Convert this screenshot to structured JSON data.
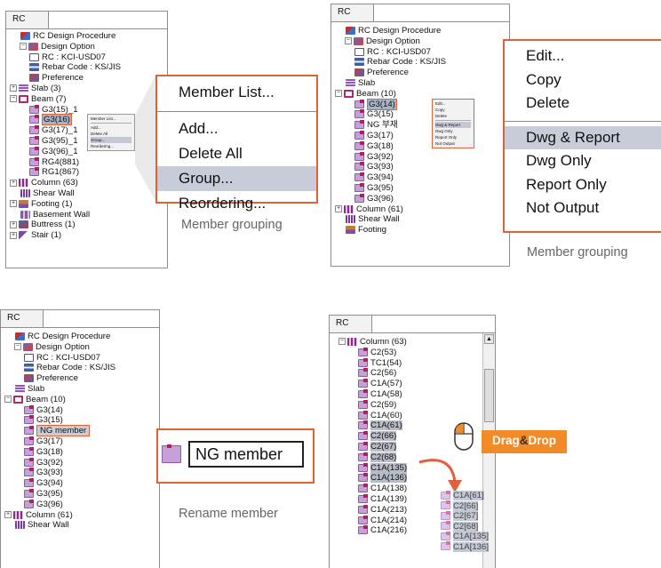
{
  "panel1": {
    "tab": "RC",
    "tree": [
      {
        "label": "RC Design Procedure",
        "indent": 0,
        "exp": "",
        "icon": "ic-root"
      },
      {
        "label": "Design Option",
        "indent": 1,
        "exp": "−",
        "icon": "ic-opt"
      },
      {
        "label": "RC : KCI-USD07",
        "indent": 2,
        "exp": "",
        "icon": "ic-rc"
      },
      {
        "label": "Rebar Code : KS/JIS",
        "indent": 2,
        "exp": "",
        "icon": "ic-rebar"
      },
      {
        "label": "Preference",
        "indent": 2,
        "exp": "",
        "icon": "ic-pref"
      },
      {
        "label": "Slab (3)",
        "indent": 0,
        "exp": "+",
        "icon": "ic-slab"
      },
      {
        "label": "Beam (7)",
        "indent": 0,
        "exp": "−",
        "icon": "ic-beam"
      },
      {
        "label": "G3(15)_1",
        "indent": 2,
        "exp": "",
        "icon": "ic-m"
      },
      {
        "label": "G3(16)",
        "indent": 2,
        "exp": "",
        "icon": "ic-m",
        "state": "sel"
      },
      {
        "label": "G3(17)_1",
        "indent": 2,
        "exp": "",
        "icon": "ic-m"
      },
      {
        "label": "G3(95)_1",
        "indent": 2,
        "exp": "",
        "icon": "ic-m"
      },
      {
        "label": "G3(96)_1",
        "indent": 2,
        "exp": "",
        "icon": "ic-m"
      },
      {
        "label": "RG4(881)",
        "indent": 2,
        "exp": "",
        "icon": "ic-m"
      },
      {
        "label": "RG1(867)",
        "indent": 2,
        "exp": "",
        "icon": "ic-m"
      },
      {
        "label": "Column (63)",
        "indent": 0,
        "exp": "+",
        "icon": "ic-col"
      },
      {
        "label": "Shear Wall",
        "indent": 0,
        "exp": "",
        "icon": "ic-wall"
      },
      {
        "label": "Footing (1)",
        "indent": 0,
        "exp": "+",
        "icon": "ic-foot"
      },
      {
        "label": "Basement Wall",
        "indent": 0,
        "exp": "",
        "icon": "ic-base"
      },
      {
        "label": "Buttress (1)",
        "indent": 0,
        "exp": "+",
        "icon": "ic-butt"
      },
      {
        "label": "Stair (1)",
        "indent": 0,
        "exp": "+",
        "icon": "ic-stair"
      }
    ],
    "context_menu": [
      {
        "label": "Member List..."
      },
      {
        "sep": true
      },
      {
        "label": "Add..."
      },
      {
        "label": "Delete All"
      },
      {
        "label": "Group...",
        "active": true
      },
      {
        "label": "Reordering..."
      }
    ],
    "zoom_menu": [
      {
        "label": "Member List..."
      },
      {
        "sep": true
      },
      {
        "label": "Add..."
      },
      {
        "label": "Delete All"
      },
      {
        "label": "Group...",
        "active": true
      },
      {
        "label": "Reordering..."
      }
    ],
    "caption": "Member grouping"
  },
  "panel2": {
    "tab": "RC",
    "tree": [
      {
        "label": "RC Design Procedure",
        "indent": 0,
        "exp": "",
        "icon": "ic-root"
      },
      {
        "label": "Design Option",
        "indent": 1,
        "exp": "−",
        "icon": "ic-opt"
      },
      {
        "label": "RC : KCI-USD07",
        "indent": 2,
        "exp": "",
        "icon": "ic-rc"
      },
      {
        "label": "Rebar Code : KS/JIS",
        "indent": 2,
        "exp": "",
        "icon": "ic-rebar"
      },
      {
        "label": "Preference",
        "indent": 2,
        "exp": "",
        "icon": "ic-pref"
      },
      {
        "label": "Slab",
        "indent": 0,
        "exp": "",
        "icon": "ic-slab"
      },
      {
        "label": "Beam (10)",
        "indent": 0,
        "exp": "−",
        "icon": "ic-beam"
      },
      {
        "label": "G3(14)",
        "indent": 2,
        "exp": "",
        "icon": "ic-m",
        "state": "sel"
      },
      {
        "label": "G3(15)",
        "indent": 2,
        "exp": "",
        "icon": "ic-m"
      },
      {
        "label": "NG 부재",
        "indent": 2,
        "exp": "",
        "icon": "ic-m"
      },
      {
        "label": "G3(17)",
        "indent": 2,
        "exp": "",
        "icon": "ic-m"
      },
      {
        "label": "G3(18)",
        "indent": 2,
        "exp": "",
        "icon": "ic-m"
      },
      {
        "label": "G3(92)",
        "indent": 2,
        "exp": "",
        "icon": "ic-m"
      },
      {
        "label": "G3(93)",
        "indent": 2,
        "exp": "",
        "icon": "ic-m"
      },
      {
        "label": "G3(94)",
        "indent": 2,
        "exp": "",
        "icon": "ic-m"
      },
      {
        "label": "G3(95)",
        "indent": 2,
        "exp": "",
        "icon": "ic-m"
      },
      {
        "label": "G3(96)",
        "indent": 2,
        "exp": "",
        "icon": "ic-m"
      },
      {
        "label": "Column (61)",
        "indent": 0,
        "exp": "+",
        "icon": "ic-col"
      },
      {
        "label": "Shear Wall",
        "indent": 0,
        "exp": "",
        "icon": "ic-wall"
      },
      {
        "label": "Footing",
        "indent": 0,
        "exp": "",
        "icon": "ic-foot"
      }
    ],
    "context_menu": [
      {
        "label": "Edit..."
      },
      {
        "label": "Copy"
      },
      {
        "label": "Delete"
      },
      {
        "sep": true
      },
      {
        "label": "Dwg & Report",
        "active": true
      },
      {
        "label": "Dwg Only"
      },
      {
        "label": "Report Only"
      },
      {
        "label": "Not Output"
      }
    ],
    "zoom_menu": [
      {
        "label": "Edit..."
      },
      {
        "label": "Copy"
      },
      {
        "label": "Delete"
      },
      {
        "sep": true
      },
      {
        "label": "Dwg & Report",
        "active": true
      },
      {
        "label": "Dwg Only"
      },
      {
        "label": "Report Only"
      },
      {
        "label": "Not Output"
      }
    ],
    "caption": "Member grouping"
  },
  "panel3": {
    "tab": "RC",
    "tree": [
      {
        "label": "RC Design Procedure",
        "indent": 0,
        "exp": "",
        "icon": "ic-root"
      },
      {
        "label": "Design Option",
        "indent": 1,
        "exp": "−",
        "icon": "ic-opt"
      },
      {
        "label": "RC : KCI-USD07",
        "indent": 2,
        "exp": "",
        "icon": "ic-rc"
      },
      {
        "label": "Rebar Code : KS/JIS",
        "indent": 2,
        "exp": "",
        "icon": "ic-rebar"
      },
      {
        "label": "Preference",
        "indent": 2,
        "exp": "",
        "icon": "ic-pref"
      },
      {
        "label": "Slab",
        "indent": 0,
        "exp": "",
        "icon": "ic-slab"
      },
      {
        "label": "Beam (10)",
        "indent": 0,
        "exp": "−",
        "icon": "ic-beam"
      },
      {
        "label": "G3(14)",
        "indent": 2,
        "exp": "",
        "icon": "ic-m"
      },
      {
        "label": "G3(15)",
        "indent": 2,
        "exp": "",
        "icon": "ic-m"
      },
      {
        "label": "NG member",
        "indent": 2,
        "exp": "",
        "icon": "ic-m",
        "state": "edit"
      },
      {
        "label": "G3(17)",
        "indent": 2,
        "exp": "",
        "icon": "ic-m"
      },
      {
        "label": "G3(18)",
        "indent": 2,
        "exp": "",
        "icon": "ic-m"
      },
      {
        "label": "G3(92)",
        "indent": 2,
        "exp": "",
        "icon": "ic-m"
      },
      {
        "label": "G3(93)",
        "indent": 2,
        "exp": "",
        "icon": "ic-m"
      },
      {
        "label": "G3(94)",
        "indent": 2,
        "exp": "",
        "icon": "ic-m"
      },
      {
        "label": "G3(95)",
        "indent": 2,
        "exp": "",
        "icon": "ic-m"
      },
      {
        "label": "G3(96)",
        "indent": 2,
        "exp": "",
        "icon": "ic-m"
      },
      {
        "label": "Column (61)",
        "indent": 0,
        "exp": "+",
        "icon": "ic-col"
      },
      {
        "label": "Shear Wall",
        "indent": 0,
        "exp": "",
        "icon": "ic-wall"
      }
    ],
    "zoom_label": "NG member",
    "caption": "Rename member"
  },
  "panel4": {
    "tab": "RC",
    "tree": [
      {
        "label": "Column (63)",
        "indent": 0,
        "exp": "−",
        "icon": "ic-col"
      },
      {
        "label": "C2(53)",
        "indent": 2,
        "exp": "",
        "icon": "ic-m"
      },
      {
        "label": "TC1(54)",
        "indent": 2,
        "exp": "",
        "icon": "ic-m"
      },
      {
        "label": "C2(56)",
        "indent": 2,
        "exp": "",
        "icon": "ic-m"
      },
      {
        "label": "C1A(57)",
        "indent": 2,
        "exp": "",
        "icon": "ic-m"
      },
      {
        "label": "C1A(58)",
        "indent": 2,
        "exp": "",
        "icon": "ic-m"
      },
      {
        "label": "C2(59)",
        "indent": 2,
        "exp": "",
        "icon": "ic-m"
      },
      {
        "label": "C1A(60)",
        "indent": 2,
        "exp": "",
        "icon": "ic-m"
      },
      {
        "label": "C1A(61)",
        "indent": 2,
        "exp": "",
        "icon": "ic-m",
        "state": "hl"
      },
      {
        "label": "C2(66)",
        "indent": 2,
        "exp": "",
        "icon": "ic-m",
        "state": "hl"
      },
      {
        "label": "C2(67)",
        "indent": 2,
        "exp": "",
        "icon": "ic-m",
        "state": "hl"
      },
      {
        "label": "C2(68)",
        "indent": 2,
        "exp": "",
        "icon": "ic-m",
        "state": "hl"
      },
      {
        "label": "C1A(135)",
        "indent": 2,
        "exp": "",
        "icon": "ic-m",
        "state": "hl"
      },
      {
        "label": "C1A(136)",
        "indent": 2,
        "exp": "",
        "icon": "ic-m",
        "state": "hl"
      },
      {
        "label": "C1A(138)",
        "indent": 2,
        "exp": "",
        "icon": "ic-m"
      },
      {
        "label": "C1A(139)",
        "indent": 2,
        "exp": "",
        "icon": "ic-m"
      },
      {
        "label": "C1A(213)",
        "indent": 2,
        "exp": "",
        "icon": "ic-m"
      },
      {
        "label": "C1A(214)",
        "indent": 2,
        "exp": "",
        "icon": "ic-m"
      },
      {
        "label": "C1A(216)",
        "indent": 2,
        "exp": "",
        "icon": "ic-m"
      }
    ],
    "drag_items": [
      "C1A[61]",
      "C2[66]",
      "C2[67]",
      "C2[68]",
      "C1A[135]",
      "C1A[136]"
    ],
    "badge_drag": "Drag",
    "badge_amp": "&",
    "badge_drop": "Drop"
  },
  "colors": {
    "accent": "#e0603a",
    "badge": "#f28a28",
    "selection": "#a9b3c4"
  }
}
